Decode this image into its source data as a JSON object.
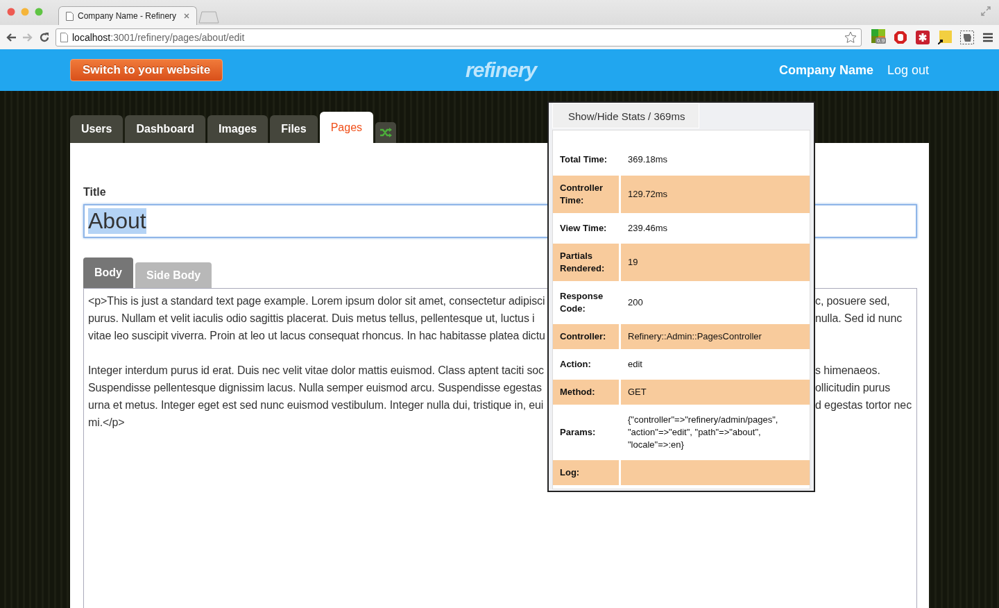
{
  "browser": {
    "tab_title": "Company Name - Refinery",
    "url_host": "localhost",
    "url_path": ":3001/refinery/pages/about/edit",
    "extension_badge": "0.9"
  },
  "header": {
    "switch_button": "Switch to your website",
    "logo": "refinery",
    "company": "Company Name",
    "logout": "Log out"
  },
  "nav_tabs": [
    {
      "label": "Users",
      "selected": false
    },
    {
      "label": "Dashboard",
      "selected": false
    },
    {
      "label": "Images",
      "selected": false
    },
    {
      "label": "Files",
      "selected": false
    },
    {
      "label": "Pages",
      "selected": true
    }
  ],
  "title_field": {
    "label": "Title",
    "value": "About",
    "value_selected": true
  },
  "editor_tabs": [
    {
      "label": "Body",
      "selected": true
    },
    {
      "label": "Side Body",
      "selected": false
    }
  ],
  "body_paragraphs": [
    [
      {
        "left": "<p>This is just a standard text page example. Lorem ipsum dolor sit amet, consectetur adipisci",
        "right": "c, posuere sed,"
      },
      {
        "left": "purus. Nullam et velit iaculis odio sagittis placerat. Duis metus tellus, pellentesque ut, luctus i",
        "right": "nulla. Sed id nunc"
      },
      {
        "left": "vitae leo suscipit viverra. Proin at leo ut lacus consequat rhoncus. In hac habitasse platea dictu"
      }
    ],
    [
      {
        "left": "Integer interdum purus id erat. Duis nec velit vitae dolor mattis euismod. Class aptent taciti soc",
        "right": "s himenaeos."
      },
      {
        "left": "Suspendisse pellentesque dignissim lacus. Nulla semper euismod arcu. Suspendisse egestas",
        "right": "ollicitudin purus"
      },
      {
        "left": "urna et metus. Integer eget est sed nunc euismod vestibulum. Integer nulla dui, tristique in, eui",
        "right": "d egestas tortor nec"
      },
      {
        "left": "mi.</p>"
      }
    ]
  ],
  "stats": {
    "toggle": "Show/Hide Stats / 369ms",
    "rows": [
      {
        "label": "Total Time:",
        "value": "369.18ms"
      },
      {
        "label": "Controller Time:",
        "value": "129.72ms"
      },
      {
        "label": "View Time:",
        "value": "239.46ms"
      },
      {
        "label": "Partials Rendered:",
        "value": "19"
      },
      {
        "label": "Response Code:",
        "value": "200"
      },
      {
        "label": "Controller:",
        "value": "Refinery::Admin::PagesController"
      },
      {
        "label": "Action:",
        "value": "edit"
      },
      {
        "label": "Method:",
        "value": "GET"
      },
      {
        "label": "Params:",
        "value": "{\"controller\"=>\"refinery/admin/pages\", \"action\"=>\"edit\", \"path\"=>\"about\", \"locale\"=>:en}"
      },
      {
        "label": "Log:"
      }
    ]
  }
}
